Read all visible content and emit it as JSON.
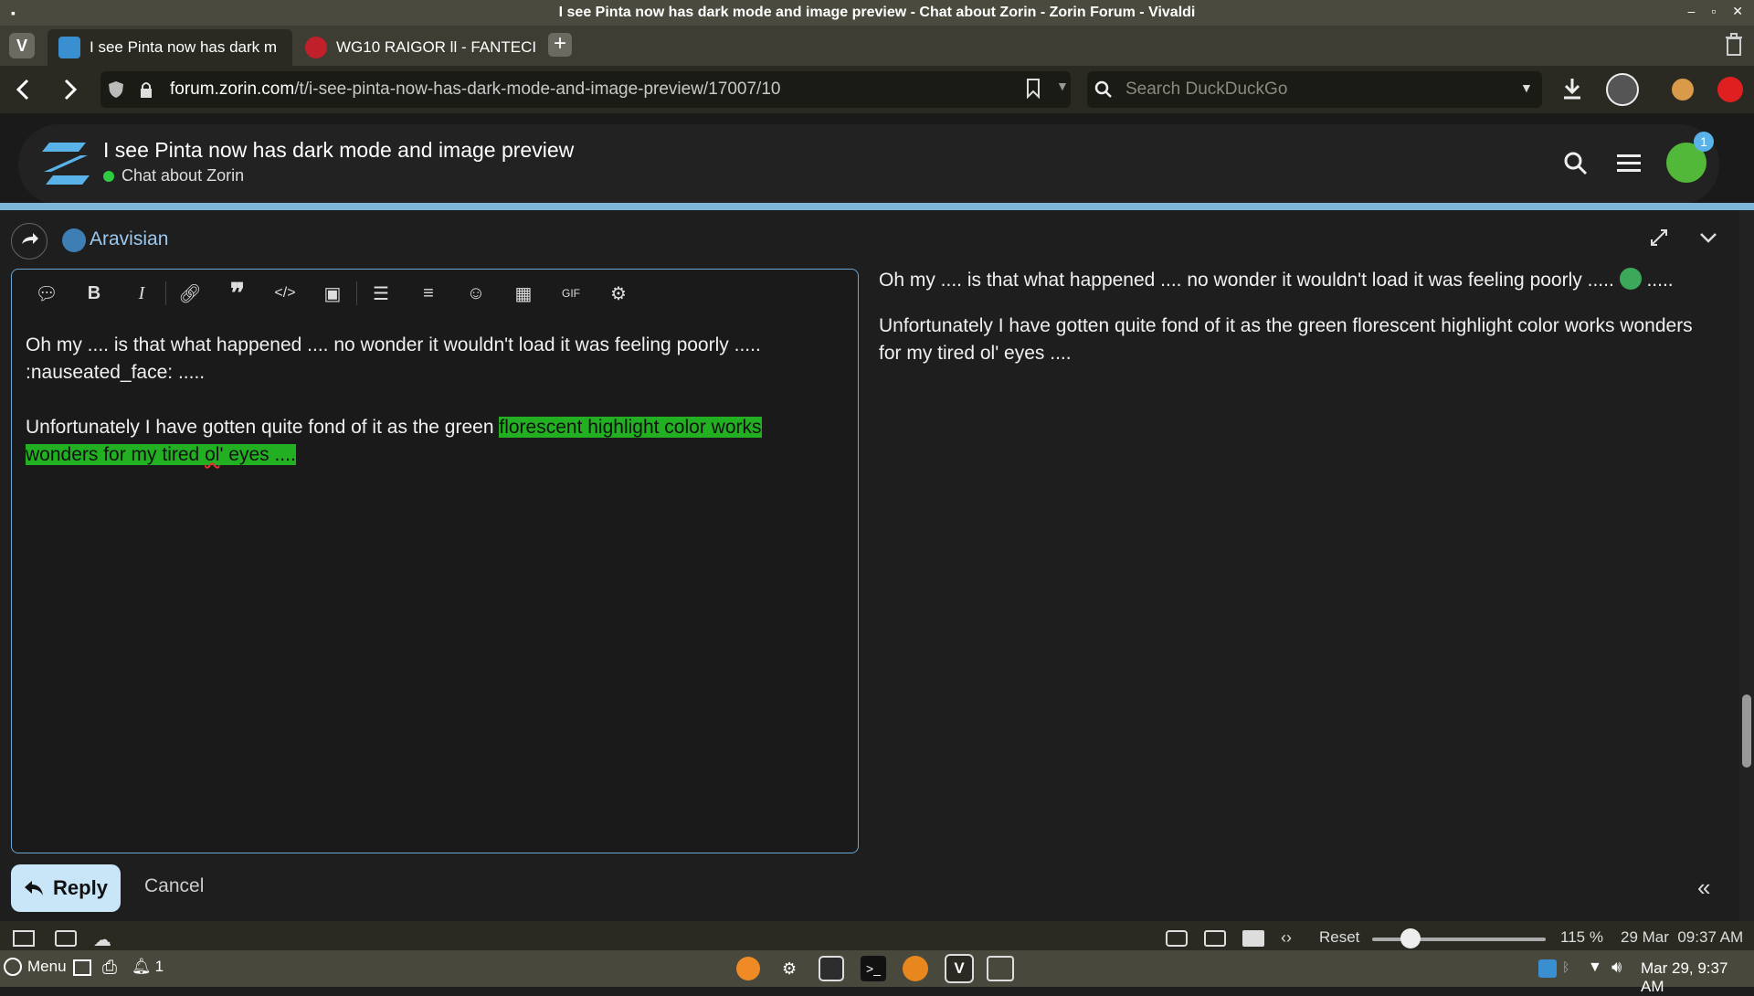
{
  "window": {
    "title": "I see Pinta now has dark mode and image preview - Chat about Zorin - Zorin Forum - Vivaldi"
  },
  "tabs": [
    {
      "label": "I see Pinta now has dark m",
      "active": true
    },
    {
      "label": "WG10 RAIGOR ll - FANTECI",
      "active": false
    }
  ],
  "address": {
    "host": "forum.zorin.com",
    "path": "/t/i-see-pinta-now-has-dark-mode-and-image-preview/17007/10",
    "search_placeholder": "Search DuckDuckGo"
  },
  "forum": {
    "topic_title": "I see Pinta now has dark mode and image preview",
    "category": "Chat about Zorin",
    "notification_count": "1"
  },
  "composer": {
    "reply_to_user": "Aravisian",
    "editor_line1": "Oh my .... is that what happened .... no wonder it wouldn't load it was feeling poorly .....",
    "editor_line2": ":nauseated_face: .....",
    "editor_p2_plain": "Unfortunately I have gotten quite fond of it as the green ",
    "editor_p2_hl1": "florescent highlight color works ",
    "editor_p2_hl2a": "wonders for my tired ",
    "editor_p2_sq": "ol",
    "editor_p2_hl2b": "' eyes .... ",
    "preview_p1_before": "Oh my .... is that what happened .... no wonder it wouldn't load it was feeling poorly .....",
    "preview_p1_after": " .....",
    "preview_p2": "Unfortunately I have gotten quite fond of it as the green florescent highlight color works wonders for my tired ol' eyes ....",
    "reply_label": "Reply",
    "cancel_label": "Cancel",
    "highlight_color": "#22b022"
  },
  "statusbar": {
    "reset_label": "Reset",
    "zoom": "115 %",
    "clock": "29 Mar  09:37 AM",
    "zoom_slider_fraction": 0.22
  },
  "panel": {
    "menu_label": "Menu",
    "notif_count": "1",
    "datetime": "Mar 29, 9:37 AM"
  },
  "icons": [
    "vivaldi-icon",
    "zorin-icon",
    "new-tab-icon",
    "trash-icon",
    "back-icon",
    "forward-icon",
    "shield-icon",
    "lock-icon",
    "bookmark-icon",
    "search-icon",
    "download-icon",
    "profile-icon",
    "cookie-icon",
    "stop-icon",
    "menu-icon",
    "reply-arrow-icon",
    "expand-icon",
    "collapse-icon"
  ]
}
